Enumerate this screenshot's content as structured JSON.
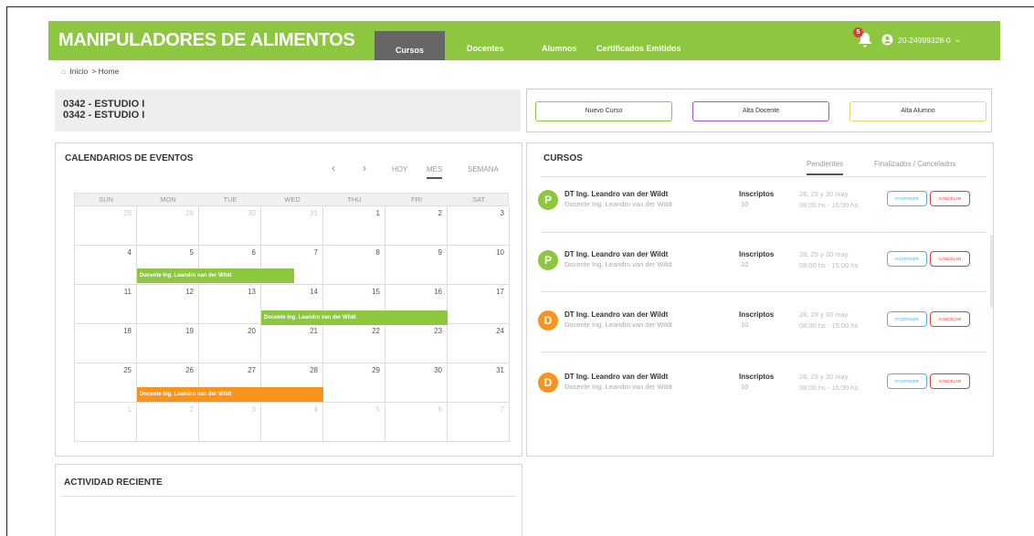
{
  "header": {
    "brand": "MANIPULADORES DE ALIMENTOS",
    "nav": [
      "Cursos",
      "Docentes",
      "Alumnos",
      "Certificados Emitidos"
    ],
    "notifications": "5",
    "user": "20-24999328-0",
    "bg_color": "#8dc63f"
  },
  "breadcrumb": {
    "home": "Inicio",
    "current": "> Home"
  },
  "school": {
    "line1": "0342 - ESTUDIO I",
    "line2": "0342 - ESTUDIO I"
  },
  "actions": [
    {
      "label": "Nuevo Curso",
      "color": "#8dc63f"
    },
    {
      "label": "Alta Docente",
      "color": "#a64ddb"
    },
    {
      "label": "Alta Alumno",
      "color": "#e6d76a"
    }
  ],
  "calendar": {
    "title": "CALENDARIOS DE EVENTOS",
    "views": [
      "HOY",
      "MES",
      "SEMANA"
    ],
    "days": [
      "SUN",
      "MON",
      "TUE",
      "WED",
      "THU",
      "FRI",
      "SAT"
    ],
    "weeks": [
      [
        "28",
        "29",
        "30",
        "31",
        "1",
        "2",
        "3"
      ],
      [
        "4",
        "5",
        "6",
        "7",
        "8",
        "9",
        "10"
      ],
      [
        "11",
        "12",
        "13",
        "14",
        "15",
        "16",
        "17"
      ],
      [
        "18",
        "19",
        "20",
        "21",
        "22",
        "23",
        "24"
      ],
      [
        "25",
        "26",
        "27",
        "28",
        "29",
        "30",
        "31"
      ],
      [
        "1",
        "2",
        "3",
        "4",
        "5",
        "6",
        "7"
      ]
    ],
    "events": [
      {
        "label": "Docente Ing. Leandro van der Wildt",
        "color": "#8dc63f"
      },
      {
        "label": "Docente Ing. Leandro van der Wildt",
        "color": "#8dc63f"
      },
      {
        "label": "Docente Ing. Leandro van der Wildt",
        "color": "#f7941d"
      }
    ]
  },
  "cursos": {
    "title": "CURSOS",
    "tabs": [
      "Pendientes",
      "Finalizados / Cancelados"
    ],
    "items": [
      {
        "initial": "P",
        "color": "#8dc63f",
        "title": "DT Ing. Leandro van der Wildt",
        "sub": "Docente Ing. Leandro van der Wildt",
        "ins_label": "Inscriptos",
        "ins": "10",
        "dates": "28, 29 y 30 may",
        "hours": "08:00 hs - 15:00 hs",
        "postpone": "POSPONER",
        "cancel": "CANCELAR"
      },
      {
        "initial": "P",
        "color": "#8dc63f",
        "title": "DT Ing. Leandro van der Wildt",
        "sub": "Docente Ing. Leandro van der Wildt",
        "ins_label": "Inscriptos",
        "ins": "10",
        "dates": "28, 29 y 30 may",
        "hours": "08:00 hs - 15:00 hs",
        "postpone": "POSPONER",
        "cancel": "CANCELAR"
      },
      {
        "initial": "D",
        "color": "#f7941d",
        "title": "DT Ing. Leandro van der Wildt",
        "sub": "Docente Ing. Leandro van der Wildt",
        "ins_label": "Inscriptos",
        "ins": "10",
        "dates": "28, 29 y 30 may",
        "hours": "08:00 hs - 15:00 hs",
        "postpone": "POSPONER",
        "cancel": "CANCELAR"
      },
      {
        "initial": "D",
        "color": "#f7941d",
        "title": "DT Ing. Leandro van der Wildt",
        "sub": "Docente Ing. Leandro van der Wildt",
        "ins_label": "Inscriptos",
        "ins": "10",
        "dates": "28, 29 y 30 may",
        "hours": "08:00 hs - 15:00 hs",
        "postpone": "POSPONER",
        "cancel": "CANCELAR"
      }
    ]
  },
  "recent": {
    "title": "ACTIVIDAD RECIENTE"
  }
}
